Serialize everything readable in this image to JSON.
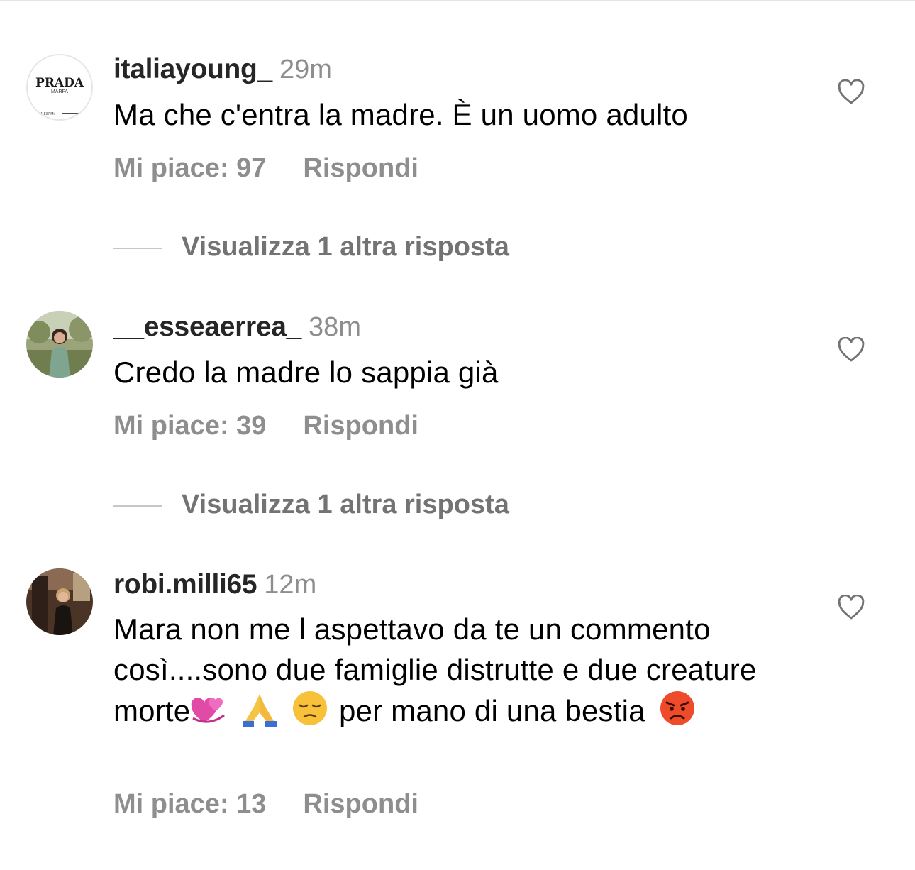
{
  "comments": [
    {
      "username": "italiayoung_",
      "time": "29m",
      "text": "Ma che c'entra la madre. È un uomo adulto",
      "likes": "Mi piace: 97",
      "reply": "Rispondi",
      "avatar": {
        "brand": "PRADA",
        "sub": "MARFA",
        "small": "1,537 Mi"
      },
      "view_replies": "Visualizza 1 altra risposta"
    },
    {
      "username": "__esseaerrea_",
      "time": "38m",
      "text": "Credo la madre lo sappia già",
      "likes": "Mi piace: 39",
      "reply": "Rispondi",
      "view_replies": "Visualizza 1 altra risposta"
    },
    {
      "username": "robi.milli65",
      "time": "12m",
      "text_parts": [
        "Mara non me l aspettavo da te un commento così....sono due famiglie distrutte e due creature morte",
        "per mano di una bestia"
      ],
      "emojis_inline": [
        "revolving-hearts-emoji",
        "folded-hands-emoji",
        "disappointed-face-emoji"
      ],
      "emoji_end": "pouting-face-emoji",
      "likes": "Mi piace: 13",
      "reply": "Rispondi"
    }
  ],
  "colors": {
    "username": "#262626",
    "secondary": "#8e8e8e",
    "view_replies": "#737373",
    "divider": "#c7c7c7"
  }
}
